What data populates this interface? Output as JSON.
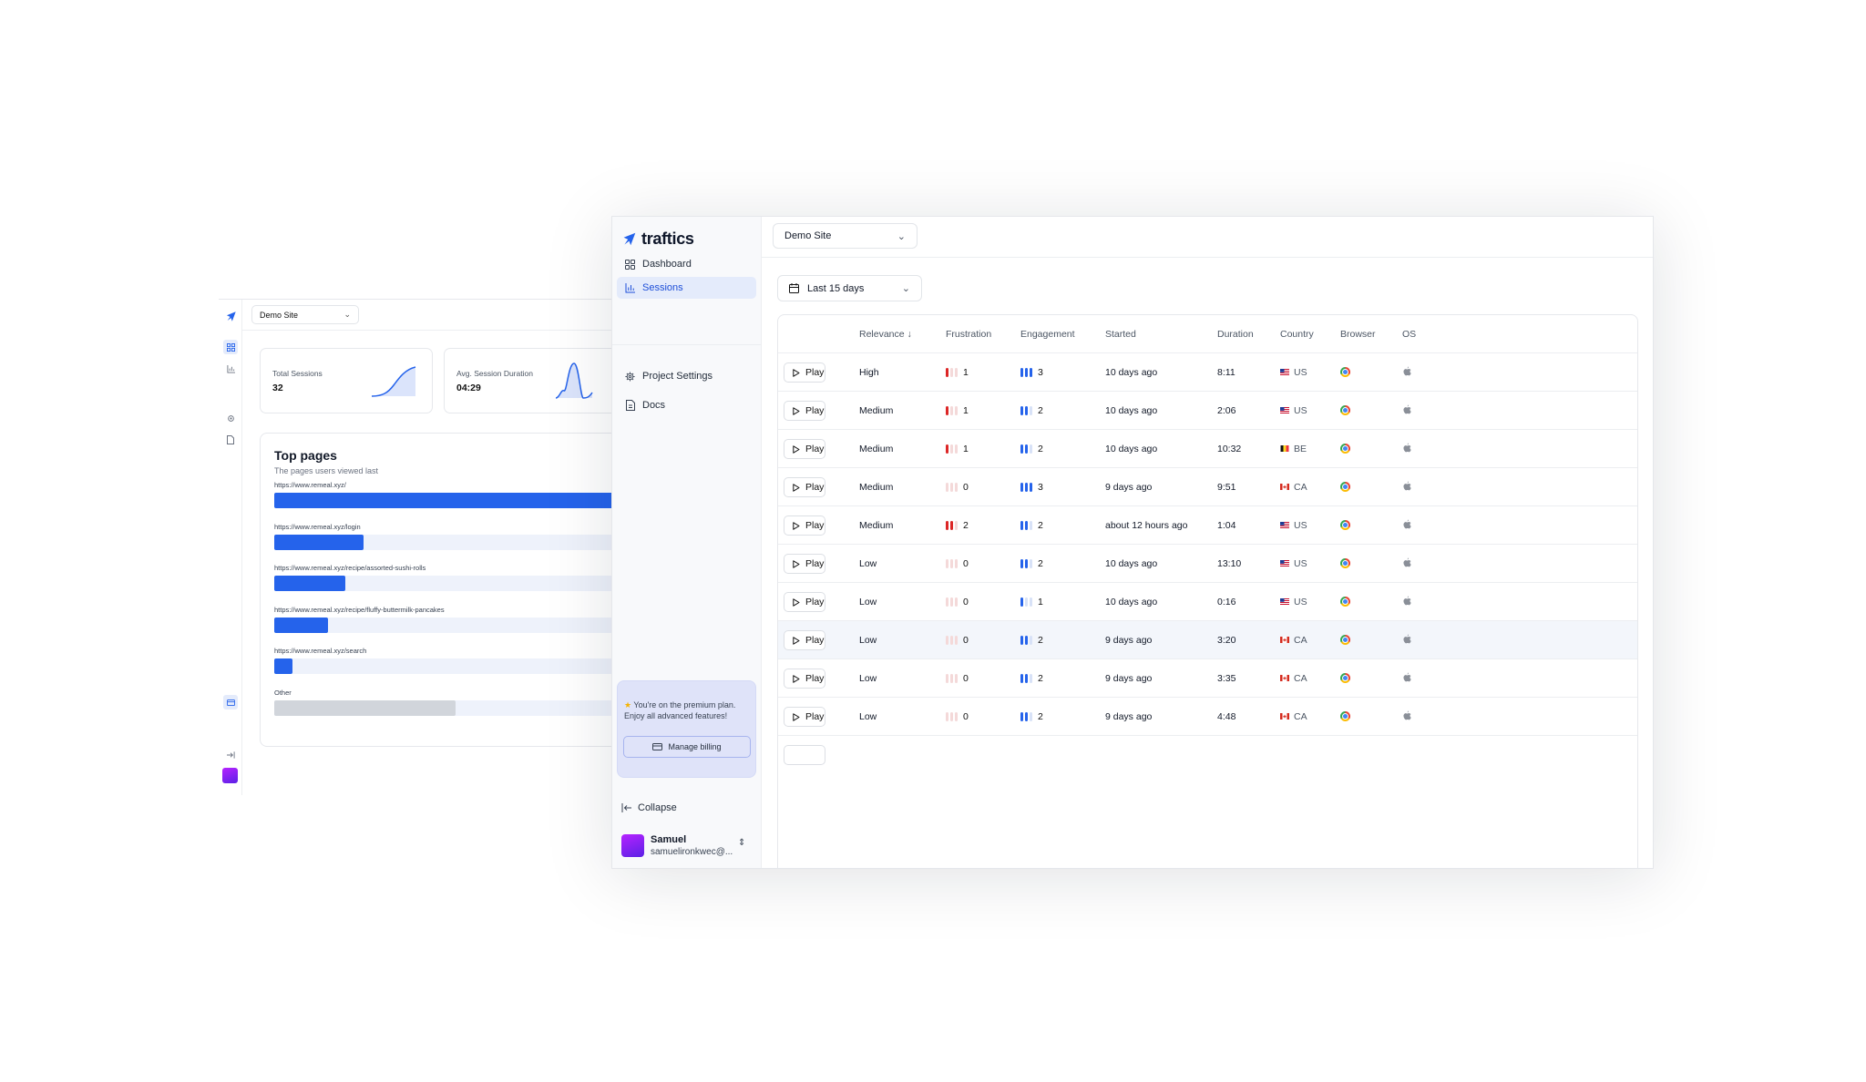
{
  "back": {
    "site_select": "Demo Site",
    "total_sessions_label": "Total Sessions",
    "total_sessions_value": "32",
    "avg_duration_label": "Avg. Session Duration",
    "avg_duration_value": "04:29",
    "top_pages": {
      "title": "Top pages",
      "subtitle": "The pages users viewed last",
      "pages": [
        {
          "url": "https://www.remeal.xyz/",
          "share": 1.0
        },
        {
          "url": "https://www.remeal.xyz/login",
          "share": 0.35
        },
        {
          "url": "https://www.remeal.xyz/recipe/assorted-sushi-rolls",
          "share": 0.28
        },
        {
          "url": "https://www.remeal.xyz/recipe/fluffy-buttermilk-pancakes",
          "share": 0.21
        },
        {
          "url": "https://www.remeal.xyz/search",
          "share": 0.07
        },
        {
          "url": "Other",
          "share": 0.71
        }
      ]
    }
  },
  "front": {
    "logo_text": "traftics",
    "nav": [
      {
        "label": "Dashboard",
        "icon": "dashboard-icon",
        "active": false
      },
      {
        "label": "Sessions",
        "icon": "bar-chart-icon",
        "active": true
      },
      {
        "label": "Project Settings",
        "icon": "gear-icon",
        "active": false
      },
      {
        "label": "Docs",
        "icon": "document-icon",
        "active": false
      }
    ],
    "premium": {
      "text": "You're on the premium plan. Enjoy all advanced features!",
      "button": "Manage billing"
    },
    "collapse_label": "Collapse",
    "user": {
      "name": "Samuel",
      "email": "samuelironkwec@..."
    },
    "site_select": "Demo Site",
    "date_select": "Last 15 days",
    "columns": [
      "Relevance",
      "Frustration",
      "Engagement",
      "Started",
      "Duration",
      "Country",
      "Browser",
      "OS"
    ],
    "play_label": "Play",
    "colors": {
      "accent": "#2563eb",
      "frustration": "#dc2626",
      "engagement": "#2563eb"
    },
    "sessions": [
      {
        "relevance": "High",
        "frustration": 1,
        "engagement": 3,
        "started": "10 days ago",
        "duration": "8:11",
        "country": "US",
        "browser": "chrome-icon",
        "os": "apple-icon"
      },
      {
        "relevance": "Medium",
        "frustration": 1,
        "engagement": 2,
        "started": "10 days ago",
        "duration": "2:06",
        "country": "US",
        "browser": "chrome-icon",
        "os": "apple-icon"
      },
      {
        "relevance": "Medium",
        "frustration": 1,
        "engagement": 2,
        "started": "10 days ago",
        "duration": "10:32",
        "country": "BE",
        "browser": "chrome-icon",
        "os": "apple-icon"
      },
      {
        "relevance": "Medium",
        "frustration": 0,
        "engagement": 3,
        "started": "9 days ago",
        "duration": "9:51",
        "country": "CA",
        "browser": "chrome-icon",
        "os": "apple-icon"
      },
      {
        "relevance": "Medium",
        "frustration": 2,
        "engagement": 2,
        "started": "about 12 hours ago",
        "duration": "1:04",
        "country": "US",
        "browser": "chrome-icon",
        "os": "apple-icon"
      },
      {
        "relevance": "Low",
        "frustration": 0,
        "engagement": 2,
        "started": "10 days ago",
        "duration": "13:10",
        "country": "US",
        "browser": "chrome-icon",
        "os": "apple-icon"
      },
      {
        "relevance": "Low",
        "frustration": 0,
        "engagement": 1,
        "started": "10 days ago",
        "duration": "0:16",
        "country": "US",
        "browser": "chrome-icon",
        "os": "apple-icon"
      },
      {
        "relevance": "Low",
        "frustration": 0,
        "engagement": 2,
        "started": "9 days ago",
        "duration": "3:20",
        "country": "CA",
        "browser": "chrome-icon",
        "os": "apple-icon",
        "highlighted": true
      },
      {
        "relevance": "Low",
        "frustration": 0,
        "engagement": 2,
        "started": "9 days ago",
        "duration": "3:35",
        "country": "CA",
        "browser": "chrome-icon",
        "os": "apple-icon"
      },
      {
        "relevance": "Low",
        "frustration": 0,
        "engagement": 2,
        "started": "9 days ago",
        "duration": "4:48",
        "country": "CA",
        "browser": "chrome-icon",
        "os": "apple-icon"
      }
    ]
  }
}
